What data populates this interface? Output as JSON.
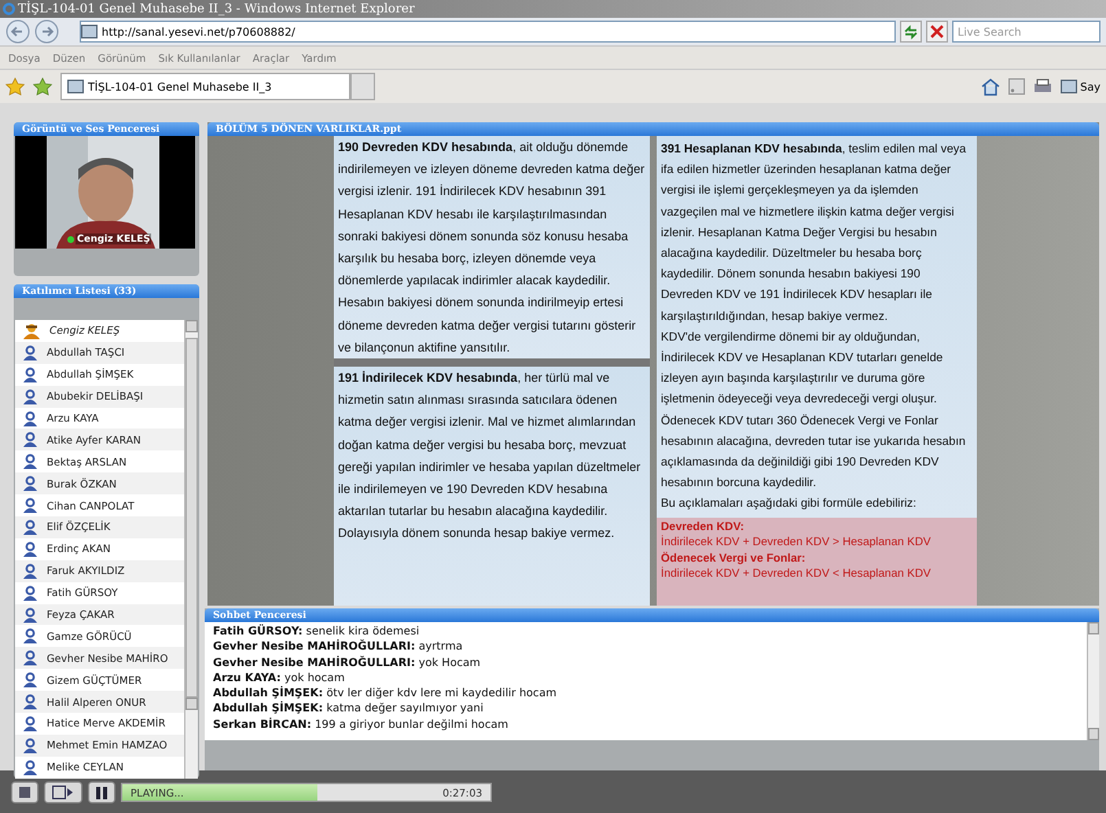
{
  "window": {
    "title": "TİŞL-104-01 Genel Muhasebe II_3 - Windows Internet Explorer"
  },
  "address": {
    "url": "http://sanal.yesevi.net/p70608882/",
    "search_placeholder": "Live Search"
  },
  "menu": [
    "Dosya",
    "Düzen",
    "Görünüm",
    "Sık Kullanılanlar",
    "Araçlar",
    "Yardım"
  ],
  "tab": {
    "title": "TİŞL-104-01 Genel Muhasebe II_3"
  },
  "toolbar_right": {
    "label": "Say"
  },
  "video_panel": {
    "title": "Görüntü ve Ses Penceresi",
    "speaker": "Cengiz KELEŞ"
  },
  "participants": {
    "title": "Katılımcı Listesi (33)",
    "items": [
      {
        "name": "Cengiz KELEŞ",
        "kind": "host"
      },
      {
        "name": "Abdullah TAŞCI",
        "kind": "guest"
      },
      {
        "name": "Abdullah ŞİMŞEK",
        "kind": "guest"
      },
      {
        "name": "Abubekir DELİBAŞI",
        "kind": "guest"
      },
      {
        "name": "Arzu KAYA",
        "kind": "guest"
      },
      {
        "name": "Atike Ayfer KARAN",
        "kind": "guest"
      },
      {
        "name": "Bektaş ARSLAN",
        "kind": "guest"
      },
      {
        "name": "Burak ÖZKAN",
        "kind": "guest"
      },
      {
        "name": "Cihan CANPOLAT",
        "kind": "guest"
      },
      {
        "name": "Elif ÖZÇELİK",
        "kind": "guest"
      },
      {
        "name": "Erdinç AKAN",
        "kind": "guest"
      },
      {
        "name": "Faruk AKYILDIZ",
        "kind": "guest"
      },
      {
        "name": "Fatih GÜRSOY",
        "kind": "guest"
      },
      {
        "name": "Feyza ÇAKAR",
        "kind": "guest"
      },
      {
        "name": "Gamze GÖRÜCÜ",
        "kind": "guest"
      },
      {
        "name": "Gevher Nesibe MAHİRO",
        "kind": "guest"
      },
      {
        "name": "Gizem GÜÇTÜMER",
        "kind": "guest"
      },
      {
        "name": "Halil Alperen ONUR",
        "kind": "guest"
      },
      {
        "name": "Hatice Merve AKDEMİR",
        "kind": "guest"
      },
      {
        "name": "Mehmet Emin HAMZAO",
        "kind": "guest"
      },
      {
        "name": "Melike CEYLAN",
        "kind": "guest"
      }
    ]
  },
  "slide": {
    "title": "BÖLÜM 5 DÖNEN VARLIKLAR.ppt",
    "left_paragraphs": [
      "**190 Devreden KDV hesabında**, ait olduğu dönemde indirilemeyen ve izleyen döneme devreden katma değer vergisi izlenir. 191 İndirilecek KDV hesabının 391 Hesaplanan KDV hesabı ile karşılaştırılmasından sonraki bakiyesi dönem sonunda söz konusu hesaba karşılık bu hesaba borç, izleyen dönemde veya dönemlerde yapılacak indirimler alacak kaydedilir. Hesabın bakiyesi dönem sonunda indirilmeyip ertesi döneme devreden katma değer vergisi tutarını gösterir ve bilançonun aktifine yansıtılır.",
      "**191 İndirilecek KDV hesabında**, her türlü mal ve hizmetin satın alınması sırasında satıcılara ödenen katma değer vergisi izlenir. Mal ve hizmet alımlarından doğan katma değer vergisi bu hesaba borç, mevzuat gereği yapılan indirimler ve hesaba yapılan düzeltmeler ile indirilemeyen ve 190 Devreden KDV hesabına aktarılan tutarlar bu hesabın alacağına kaydedilir. Dolayısıyla dönem sonunda hesap bakiye vermez."
    ],
    "right_paragraphs": [
      "**391 Hesaplanan KDV hesabında**, teslim edilen mal veya ifa edilen hizmetler üzerinden hesaplanan katma değer vergisi ile işlemi gerçekleşmeyen ya da işlemden vazgeçilen mal ve hizmetlere ilişkin katma değer vergisi izlenir. Hesaplanan Katma Değer Vergisi bu hesabın alacağına kaydedilir. Düzeltmeler bu hesaba borç kaydedilir. Dönem sonunda hesabın bakiyesi 190 Devreden KDV ve 191 İndirilecek KDV hesapları ile karşılaştırıldığından, hesap bakiye vermez.",
      "KDV'de vergilendirme dönemi bir ay olduğundan, İndirilecek KDV ve Hesaplanan KDV tutarları genelde izleyen ayın başında karşılaştırılır ve duruma göre işletmenin ödeyeceği veya devredeceği vergi oluşur. Ödenecek KDV tutarı 360 Ödenecek Vergi ve Fonlar hesabının alacağına, devreden tutar ise yukarıda hesabın açıklamasında da değinildiği gibi 190 Devreden KDV hesabının borcuna kaydedilir.",
      "Bu açıklamaları aşağıdaki gibi formüle edebiliriz:"
    ],
    "formulas": [
      {
        "heading": "Devreden KDV:",
        "formula": "İndirilecek KDV + Devreden KDV > Hesaplanan KDV"
      },
      {
        "heading": "Ödenecek Vergi ve Fonlar:",
        "formula": "İndirilecek KDV + Devreden KDV < Hesaplanan KDV"
      }
    ]
  },
  "chat": {
    "title": "Sohbet Penceresi",
    "messages": [
      {
        "author": "Fatih GÜRSOY:",
        "text": "senelik kira ödemesi"
      },
      {
        "author": "Gevher Nesibe MAHİROĞULLARI:",
        "text": "ayrtrma"
      },
      {
        "author": "Gevher Nesibe MAHİROĞULLARI:",
        "text": "yok Hocam"
      },
      {
        "author": "Arzu KAYA:",
        "text": "yok hocam"
      },
      {
        "author": "Abdullah ŞİMŞEK:",
        "text": "ötv ler diğer kdv lere mi kaydedilir hocam"
      },
      {
        "author": "Abdullah ŞİMŞEK:",
        "text": "katma değer sayılmıyor yani"
      },
      {
        "author": "Serkan BİRCAN:",
        "text": "199 a giriyor bunlar değilmi hocam"
      }
    ]
  },
  "player": {
    "status": "PLAYING...",
    "time": "0:27:03",
    "level": 0.53
  }
}
